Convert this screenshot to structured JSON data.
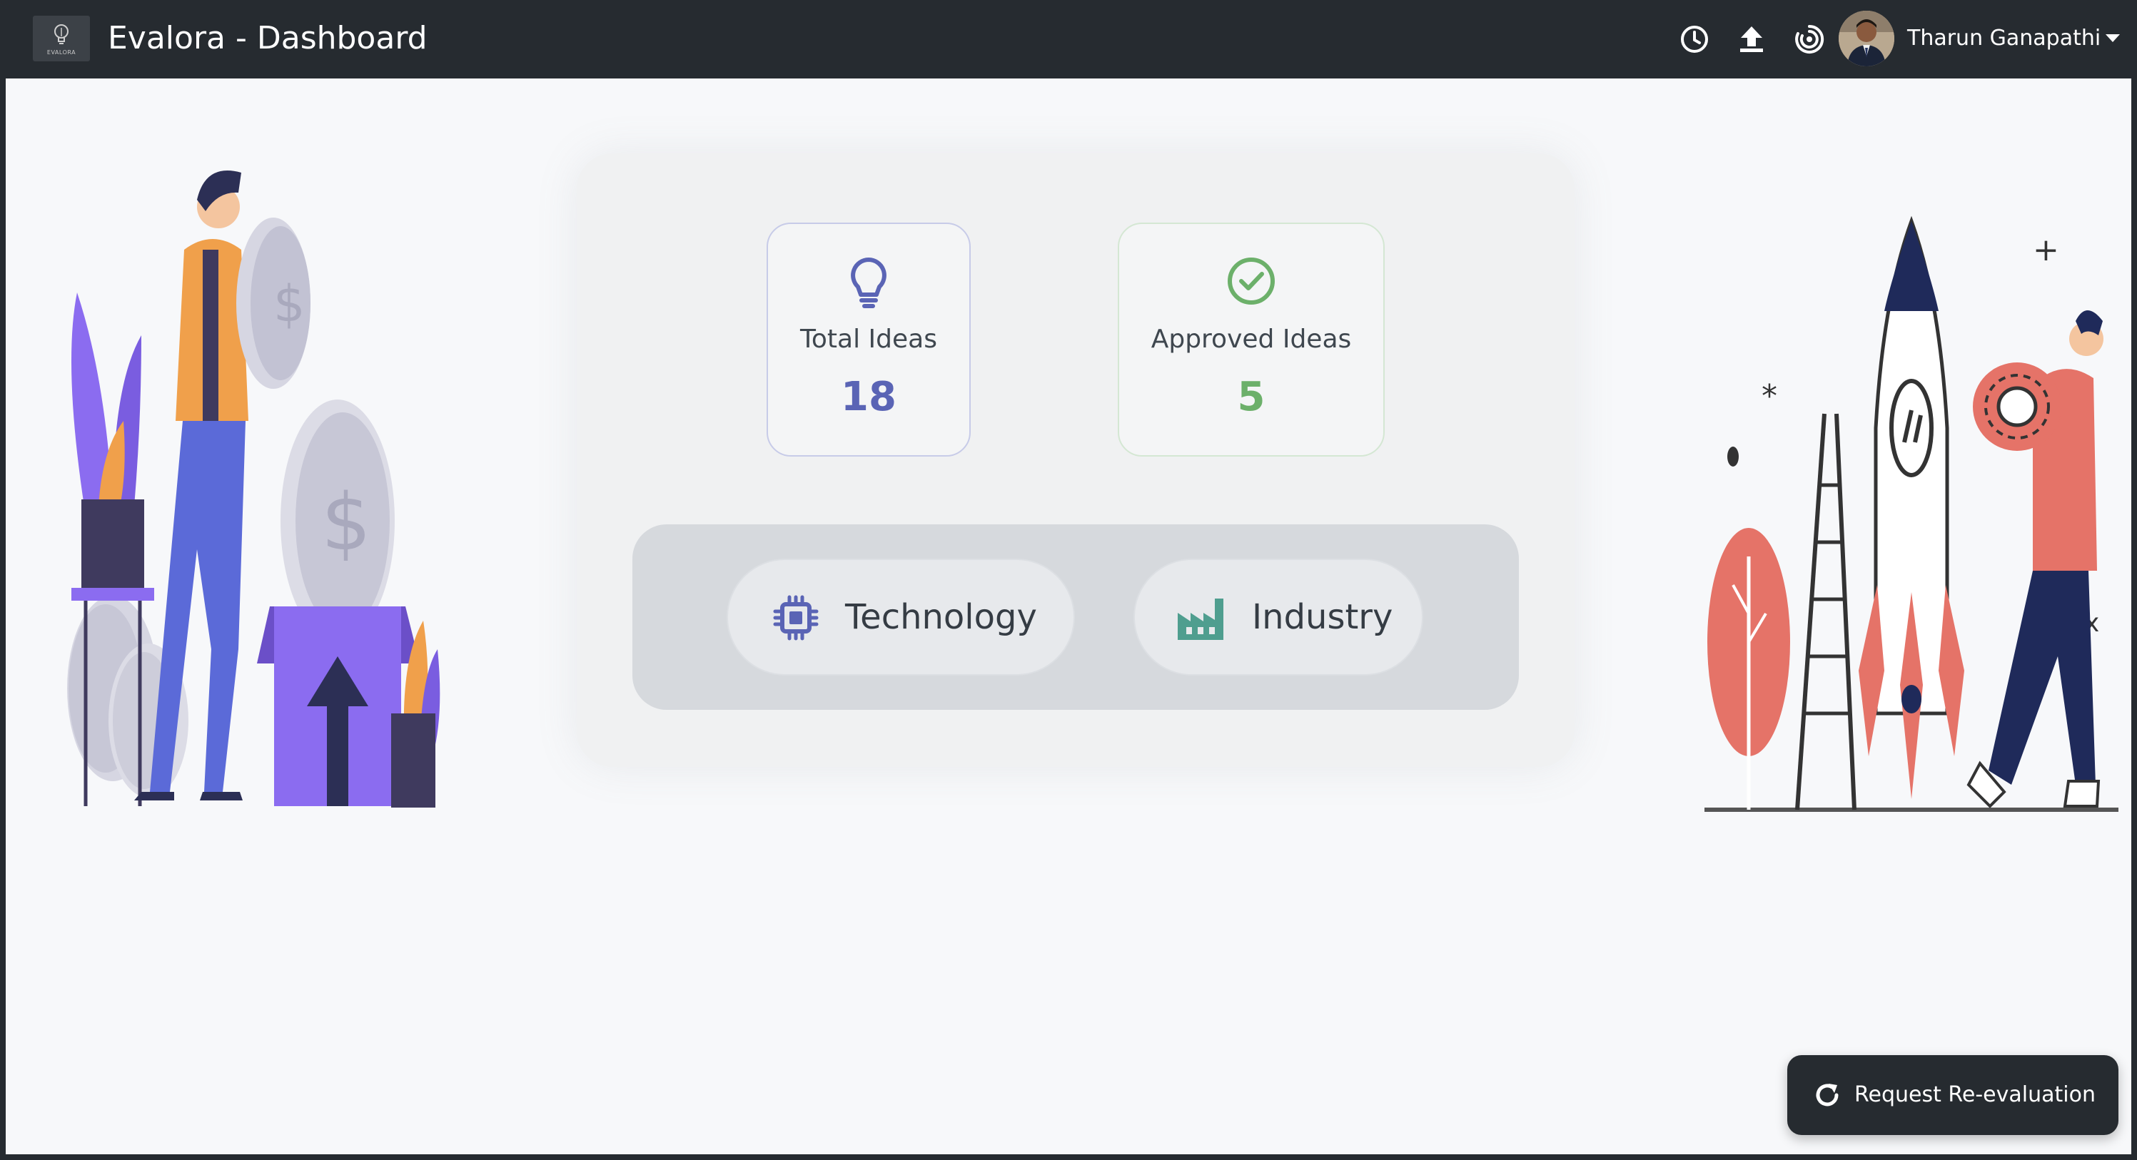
{
  "header": {
    "logo_text": "EVALORA",
    "title": "Evalora - Dashboard",
    "user_name": "Tharun Ganapathi",
    "icons": [
      "clock-icon",
      "upload-icon",
      "spiral-icon"
    ]
  },
  "stats": {
    "total_ideas": {
      "label": "Total Ideas",
      "value": "18",
      "icon": "lightbulb-icon",
      "color": "#5a64b5"
    },
    "approved_ideas": {
      "label": "Approved Ideas",
      "value": "5",
      "icon": "check-circle-icon",
      "color": "#6cb06a"
    }
  },
  "categories": [
    {
      "label": "Technology",
      "icon": "chip-icon",
      "color": "#5a64b5"
    },
    {
      "label": "Industry",
      "icon": "factory-icon",
      "color": "#4f9e8f"
    }
  ],
  "actions": {
    "reevaluation_label": "Request Re-evaluation",
    "reevaluation_icon": "refresh-icon"
  },
  "colors": {
    "topbar": "#262b30",
    "background": "#f7f8fa",
    "accent_purple": "#8b6cf0",
    "accent_coral": "#e57368",
    "navy": "#1f2a5a"
  }
}
